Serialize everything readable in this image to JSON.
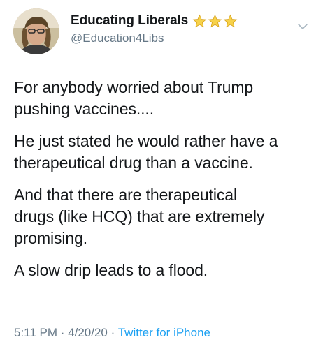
{
  "author": {
    "display_name": "Educating Liberals",
    "handle": "@Education4Libs",
    "badge_icons": [
      "star-icon",
      "star-icon",
      "star-icon"
    ]
  },
  "tweet": {
    "paragraphs": [
      "For anybody worried about Trump\npushing vaccines....",
      "He just stated he would rather have a\ntherapeutical drug than a vaccine.",
      "And that there are therapeutical\ndrugs (like HCQ) that are extremely\npromising.",
      "A slow drip leads to a flood."
    ],
    "time": "5:11 PM",
    "date": "4/20/20",
    "source": "Twitter for iPhone",
    "separator": " · "
  },
  "colors": {
    "text": "#14171a",
    "secondary": "#657786",
    "link": "#1da1f2",
    "star": "#f5c518"
  },
  "icons": {
    "more": "chevron-down-icon"
  }
}
